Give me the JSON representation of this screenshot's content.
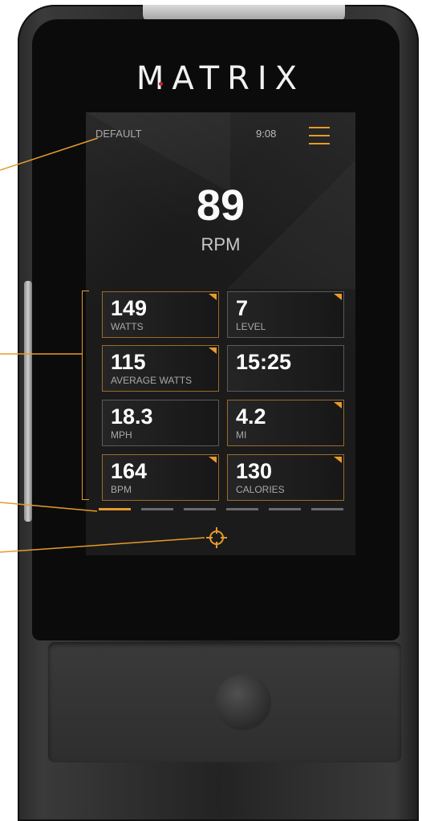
{
  "brand": {
    "logo_text": "MATRIX",
    "dot_color": "#c0272d"
  },
  "screen": {
    "profile": "DEFAULT",
    "time": "9:08",
    "menu_icon": "hamburger-menu-icon",
    "primary": {
      "value": "89",
      "label": "RPM"
    },
    "tiles": [
      {
        "value": "149",
        "label": "WATTS",
        "corner": true
      },
      {
        "value": "7",
        "label": "LEVEL",
        "corner": true
      },
      {
        "value": "115",
        "label": "AVERAGE WATTS",
        "corner": true
      },
      {
        "value": "15:25",
        "label": "",
        "corner": false
      },
      {
        "value": "18.3",
        "label": "MPH",
        "corner": false
      },
      {
        "value": "4.2",
        "label": "MI",
        "corner": true
      },
      {
        "value": "164",
        "label": "BPM",
        "corner": true
      },
      {
        "value": "130",
        "label": "CALORIES",
        "corner": true
      }
    ],
    "pager": {
      "pages": 6,
      "active_index": 0
    },
    "focus_icon": "crosshair-target-icon"
  },
  "colors": {
    "accent": "#e79a2b",
    "screen_bg": "#1b1b1b",
    "device": "#232323"
  }
}
